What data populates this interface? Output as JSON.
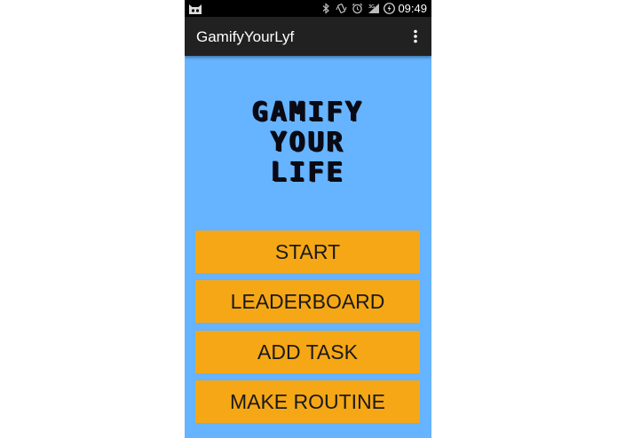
{
  "status_bar": {
    "time": "09:49",
    "icons": [
      "cat-notification-icon",
      "bluetooth-icon",
      "vibrate-icon",
      "alarm-icon",
      "signal-icon",
      "battery-charging-icon"
    ]
  },
  "action_bar": {
    "title": "GamifyYourLyf",
    "overflow_icon": "more-vert-icon"
  },
  "logo": {
    "line1": "GAMIFY",
    "line2": "YOUR",
    "line3": "LIFE"
  },
  "buttons": {
    "start": "START",
    "leaderboard": "LEADERBOARD",
    "add_task": "ADD TASK",
    "make_routine": "MAKE ROUTINE"
  },
  "colors": {
    "background": "#66b3ff",
    "button": "#f5a716",
    "action_bar": "#212121",
    "status_bar": "#000000"
  }
}
